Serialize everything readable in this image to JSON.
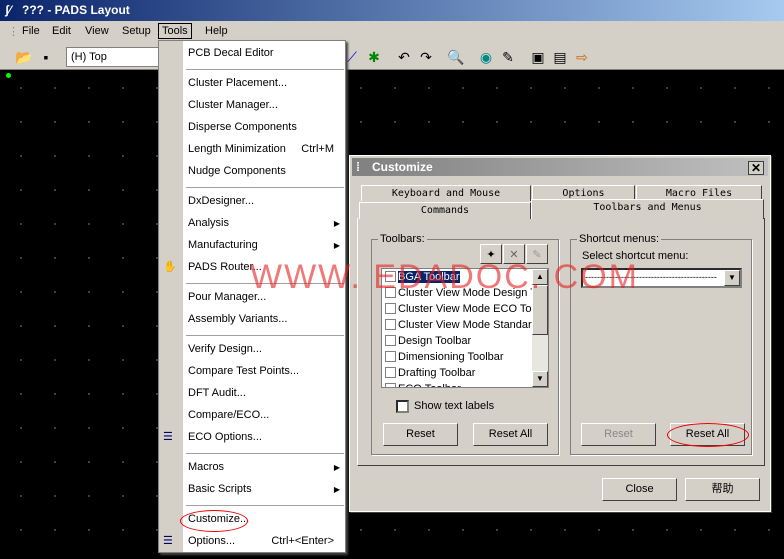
{
  "window": {
    "title": "??? - PADS Layout"
  },
  "menubar": [
    "File",
    "Edit",
    "View",
    "Setup",
    "Tools",
    "Help"
  ],
  "toolbar": {
    "layer": "(H) Top"
  },
  "tools_menu": [
    {
      "label": "PCB Decal Editor"
    },
    {
      "label": "Cluster Placement..."
    },
    {
      "label": "Cluster Manager..."
    },
    {
      "label": "Disperse Components"
    },
    {
      "label": "Length Minimization",
      "shortcut": "Ctrl+M"
    },
    {
      "label": "Nudge Components"
    },
    {
      "label": "DxDesigner..."
    },
    {
      "label": "Analysis",
      "submenu": true
    },
    {
      "label": "Manufacturing",
      "submenu": true
    },
    {
      "label": "PADS Router...",
      "icon": "router-icon"
    },
    {
      "label": "Pour Manager..."
    },
    {
      "label": "Assembly Variants..."
    },
    {
      "label": "Verify Design..."
    },
    {
      "label": "Compare Test Points..."
    },
    {
      "label": "DFT Audit..."
    },
    {
      "label": "Compare/ECO..."
    },
    {
      "label": "ECO Options...",
      "icon": "eco-options-icon"
    },
    {
      "label": "Macros",
      "submenu": true
    },
    {
      "label": "Basic Scripts",
      "submenu": true
    },
    {
      "label": "Customize..."
    },
    {
      "label": "Options...",
      "shortcut": "Ctrl+<Enter>",
      "icon": "options-icon"
    }
  ],
  "dialog": {
    "title": "Customize",
    "tabs_back": [
      "Keyboard and Mouse",
      "Options",
      "Macro Files"
    ],
    "tabs_front": [
      "Commands",
      "Toolbars and Menus"
    ],
    "active_tab": "Toolbars and Menus",
    "toolbars_label": "Toolbars:",
    "toolbars": [
      "BGA Toolbar",
      "Cluster View Mode Design Toolbar",
      "Cluster View Mode ECO Toolbar",
      "Cluster View Mode Standard",
      "Design Toolbar",
      "Dimensioning Toolbar",
      "Drafting Toolbar",
      "ECO Toolbar"
    ],
    "selected_toolbar": "BGA Toolbar",
    "show_text_labels": "Show text labels",
    "reset": "Reset",
    "reset_all": "Reset All",
    "shortcut_label": "Shortcut menus:",
    "select_shortcut_label": "Select shortcut menu:",
    "shortcut_value": "--------------------------------------------",
    "close": "Close",
    "help": "帮助"
  },
  "watermark": "WWW. EDADOC. COM",
  "highlight_color": "#e00000"
}
